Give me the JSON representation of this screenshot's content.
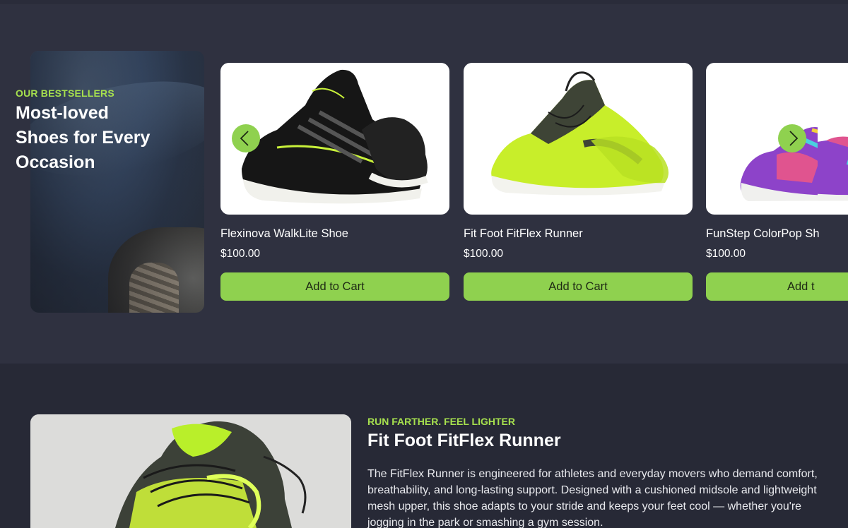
{
  "colors": {
    "accent": "#8fd14f",
    "eyebrow": "#a6e04e",
    "background": "#2f3140",
    "section_alt": "#272936"
  },
  "promo": {
    "eyebrow": "OUR BESTSELLERS",
    "title": "Most-loved Shoes for Every Occasion"
  },
  "carousel": {
    "prev_icon": "chevron-left-icon",
    "next_icon": "chevron-right-icon",
    "products": [
      {
        "name": "Flexinova WalkLite Shoe",
        "price": "$100.00",
        "button": "Add to Cart"
      },
      {
        "name": "Fit Foot FitFlex Runner",
        "price": "$100.00",
        "button": "Add to Cart"
      },
      {
        "name": "FunStep ColorPop Sh",
        "price": "$100.00",
        "button": "Add to Cart"
      }
    ]
  },
  "featured": {
    "eyebrow": "RUN FARTHER. FEEL LIGHTER",
    "title": "Fit Foot FitFlex Runner",
    "description": "The FitFlex Runner is engineered for athletes and everyday movers who demand comfort, breathability, and long-lasting support. Designed with a cushioned midsole and lightweight mesh upper, this shoe adapts to your stride and keeps your feet cool — whether you're jogging in the park or smashing a gym session."
  }
}
